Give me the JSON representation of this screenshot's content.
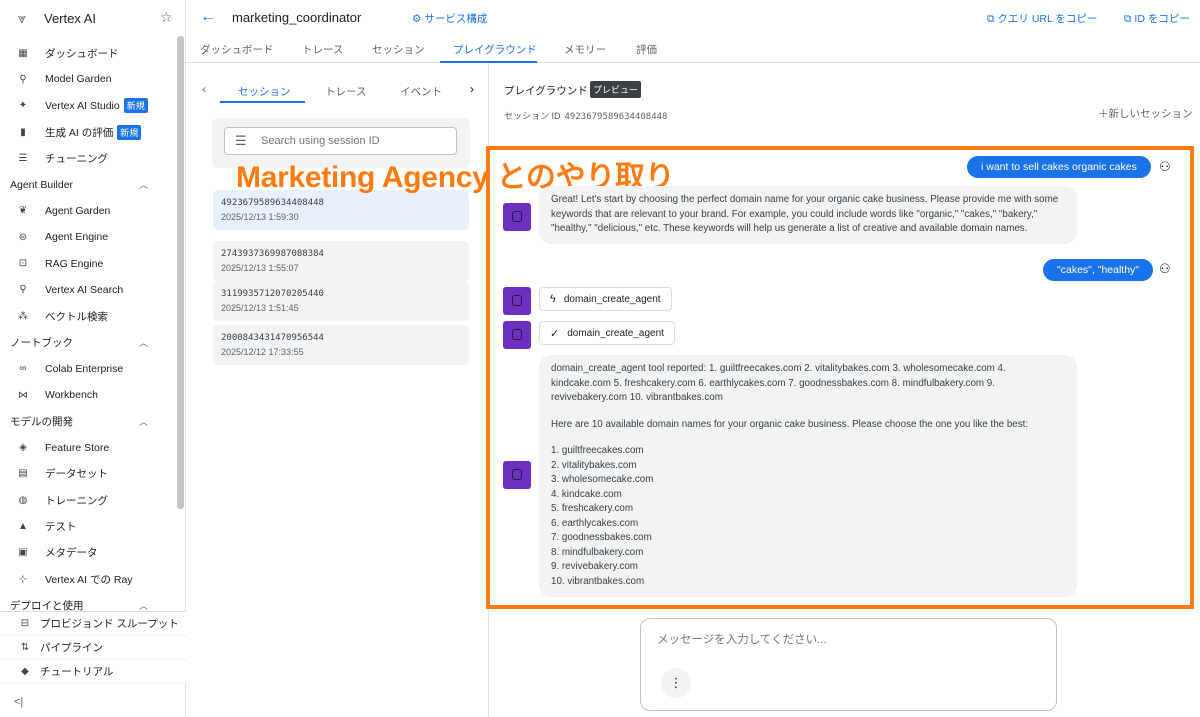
{
  "app": {
    "name": "Vertex AI"
  },
  "sidebar": {
    "items_top": [
      {
        "label": "ダッシュボード",
        "icon": "dashboard-icon",
        "glyph": "▦"
      },
      {
        "label": "Model Garden",
        "icon": "model-garden-icon",
        "glyph": "⚲"
      },
      {
        "label": "Vertex AI Studio",
        "icon": "sparkle-icon",
        "glyph": "✦",
        "badge": "新規"
      },
      {
        "label": "生成 AI の評価",
        "icon": "bar-chart-icon",
        "glyph": "▮",
        "badge": "新規"
      },
      {
        "label": "チューニング",
        "icon": "tune-icon",
        "glyph": "☰"
      }
    ],
    "section_agent": "Agent Builder",
    "items_agent": [
      {
        "label": "Agent Garden",
        "icon": "agent-garden-icon",
        "glyph": "❦"
      },
      {
        "label": "Agent Engine",
        "icon": "agent-engine-icon",
        "glyph": "⊜"
      },
      {
        "label": "RAG Engine",
        "icon": "rag-engine-icon",
        "glyph": "⊡"
      },
      {
        "label": "Vertex AI Search",
        "icon": "search-icon",
        "glyph": "⚲"
      },
      {
        "label": "ベクトル検索",
        "icon": "vector-search-icon",
        "glyph": "⁂"
      }
    ],
    "section_notebook": "ノートブック",
    "items_notebook": [
      {
        "label": "Colab Enterprise",
        "icon": "colab-icon",
        "glyph": "∞"
      },
      {
        "label": "Workbench",
        "icon": "workbench-icon",
        "glyph": "⋈"
      }
    ],
    "section_model": "モデルの開発",
    "items_model": [
      {
        "label": "Feature Store",
        "icon": "feature-store-icon",
        "glyph": "◈"
      },
      {
        "label": "データセット",
        "icon": "dataset-icon",
        "glyph": "▤"
      },
      {
        "label": "トレーニング",
        "icon": "training-icon",
        "glyph": "◍"
      },
      {
        "label": "テスト",
        "icon": "flask-icon",
        "glyph": "▲"
      },
      {
        "label": "メタデータ",
        "icon": "metadata-icon",
        "glyph": "▣"
      },
      {
        "label": "Vertex AI での Ray",
        "icon": "ray-icon",
        "glyph": "⊹"
      }
    ],
    "section_deploy": "デプロイと使用",
    "items_bottom": [
      {
        "label": "プロビジョンド スループット",
        "icon": "throughput-icon",
        "glyph": "⊟"
      },
      {
        "label": "パイプライン",
        "icon": "pipeline-icon",
        "glyph": "⇅"
      },
      {
        "label": "チュートリアル",
        "icon": "tutorial-icon",
        "glyph": "◆"
      }
    ],
    "collapse_glyph": "<|"
  },
  "header": {
    "title": "marketing_coordinator",
    "service_config": "サービス構成",
    "copy_query_url": "クエリ URL をコピー",
    "copy_id": "ID をコピー"
  },
  "tabs": [
    "ダッシュボード",
    "トレース",
    "セッション",
    "プレイグラウンド",
    "メモリー",
    "評価"
  ],
  "active_tab": "プレイグラウンド",
  "session_pane": {
    "tabs": [
      "セッション",
      "トレース",
      "イベント"
    ],
    "search_placeholder": "Search using session ID",
    "sessions": [
      {
        "id": "4923679589634408448",
        "time": "2025/12/13 1:59:30"
      },
      {
        "id": "2743937369987088384",
        "time": "2025/12/13 1:55:07"
      },
      {
        "id": "3119935712070205440",
        "time": "2025/12/13 1:51:45"
      },
      {
        "id": "2000843431470956544",
        "time": "2025/12/12 17:33:55"
      }
    ]
  },
  "playground": {
    "title": "プレイグラウンド",
    "badge": "プレビュー",
    "session_id_label": "セッション ID",
    "session_id": "4923679589634408448",
    "new_session": "新しいセッション",
    "highlight_label": "Marketing Agency とのやり取り",
    "messages": {
      "user1": "i want to sell cakes organic cakes",
      "agent1": "Great! Let's start by choosing the perfect domain name for your organic cake business. Please provide me with some keywords that are relevant to your brand. For example, you could include words like \"organic,\" \"cakes,\" \"bakery,\" \"healthy,\" \"delicious,\" etc. These keywords will help us generate a list of creative and available domain names.",
      "user2": "\"cakes\", \"healthy\"",
      "tool_call": "domain_create_agent",
      "tool_done": "domain_create_agent",
      "agent2_report": "domain_create_agent tool reported: 1. guiltfreecakes.com 2. vitalitybakes.com 3. wholesomecake.com 4. kindcake.com 5. freshcakery.com 6. earthlycakes.com 7. goodnessbakes.com 8. mindfulbakery.com 9. revivebakery.com 10. vibrantbakes.com",
      "agent2_intro": "Here are 10 available domain names for your organic cake business. Please choose the one you like the best:",
      "agent2_list": [
        "1. guiltfreecakes.com",
        "2. vitalitybakes.com",
        "3. wholesomecake.com",
        "4. kindcake.com",
        "5. freshcakery.com",
        "6. earthlycakes.com",
        "7. goodnessbakes.com",
        "8. mindfulbakery.com",
        "9. revivebakery.com",
        "10. vibrantbakes.com"
      ]
    },
    "composer_placeholder": "メッセージを入力してください..."
  },
  "colors": {
    "accent": "#1a73e8",
    "highlight": "#ff7a0f",
    "agent_avatar": "#6c2fbf"
  }
}
